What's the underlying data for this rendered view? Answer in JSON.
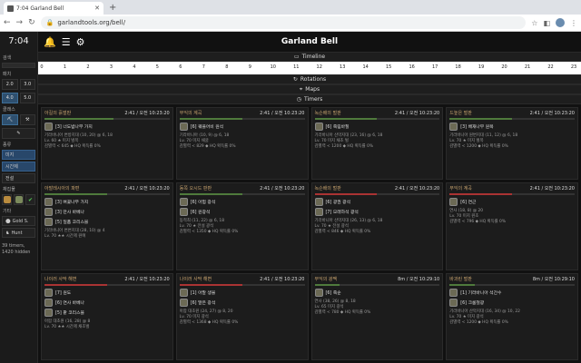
{
  "browser": {
    "tab_title": "7:04 Garland Bell",
    "url": "garlandtools.org/bell/"
  },
  "sidebar": {
    "clock": "7:04",
    "search_label": "검색",
    "patch_label": "패치",
    "patches": [
      "2.0",
      "3.0",
      "4.0",
      "5.0"
    ],
    "class_label": "클래스",
    "type_label": "종류",
    "types": [
      "미지",
      "시간제",
      "전설"
    ],
    "collect_label": "채집물",
    "other_label": "기타",
    "gold_label": "Gold S.",
    "hunt_label": "Hunt",
    "footer": "39 timers, 1420 hidden"
  },
  "header": {
    "title": "Garland Bell"
  },
  "sections": {
    "timeline": "Timeline",
    "rotations": "Rotations",
    "maps": "Maps",
    "timers": "Timers"
  },
  "timeline_hours": [
    "0",
    "1",
    "2",
    "3",
    "4",
    "5",
    "6",
    "7",
    "8",
    "9",
    "10",
    "11",
    "12",
    "13",
    "14",
    "15",
    "16",
    "17",
    "18",
    "19",
    "20",
    "21",
    "22",
    "23"
  ],
  "cards": [
    {
      "name": "아길의 흙벌판",
      "time": "2:41 / 오전 10:23:20",
      "items": [
        "[3] 너도밤나무 가지"
      ],
      "meta": [
        "기라바니아 변방지대 (10, 20) @ 6, 18",
        "Lv. 60 ★ 미지 벌목",
        "감별력 < 645 ◆ HQ 획득률 0%"
      ],
      "bar": 0.55
    },
    {
      "name": "무익의 계곡",
      "time": "2:41 / 오전 10:23:20",
      "items": [
        "[6] 퀘플어비 원석"
      ],
      "meta": [
        "기라바니아 (10, 9) @ 6, 18",
        "Lv. 70 미지 채굴",
        "감별력 < 829 ◆ HQ 획득률 0%"
      ],
      "bar": 0.5
    },
    {
      "name": "녹슨배의 벌판",
      "time": "2:41 / 오전 10:23:20",
      "items": [
        "[6] 죽림바질"
      ],
      "meta": [
        "기라바니아 산악지대 (23, 16) @ 6, 18",
        "Lv. 70 미지 채초 벌",
        "감별력 < 1200 ◆ HQ 획득률 0%"
      ],
      "bar": 0.5
    },
    {
      "name": "드높은 벌판",
      "time": "2:41 / 오전 10:23:20",
      "items": [
        "[3] 배재나무 원목"
      ],
      "meta": [
        "기라바니아 원변지대 (11, 12) @ 6, 18",
        "Lv. 70 ★ 미지 벌목",
        "감별력 < 1200 ◆ HQ 획득률 0%"
      ],
      "bar": 0.5
    },
    {
      "name": "아발레시아의 파편",
      "time": "2:41 / 오전 10:23:20",
      "items": [
        "[3] 벼꽃나무 가지",
        "[3] 만사 바베나",
        "[5] 일품 코리스블"
      ],
      "meta": [
        "기라바니아 변변지대 (28, 10) @ 4",
        "Lv. 70 ★★ 시간제 원예"
      ],
      "bar": 0.5
    },
    {
      "name": "동쪽 오시드 판판",
      "time": "2:41 / 오전 10:23:20",
      "items": [
        "[6] 아험 광석",
        "[6] 원광석"
      ],
      "meta": [
        "동적최 (11, 22) @ 6, 18",
        "Lv. 70 ★ 전설 광석",
        "감별력 < 1350 ◆ HQ 획득률 0%"
      ],
      "bar": 0.5
    },
    {
      "name": "녹슨배의 벌판",
      "time": "2:41 / 오전 10:23:20",
      "items": [
        "[6] 광권 광석",
        "[7] 모래하석 광석"
      ],
      "meta": [
        "기라바니아 산악지대 (26, 13) @ 6, 18",
        "Lv. 70 ★ 전설 광석",
        "감별력 < 846 ◆ HQ 획득률 0%"
      ],
      "bar": 0.5,
      "red": true
    },
    {
      "name": "무익의 계곡",
      "time": "2:41 / 오전 10:23:20",
      "items": [
        "[6] 연근"
      ],
      "meta": [
        "연사 (18, 8) @ 20",
        "Lv. 70 미지 원초",
        "감별력 < 796 ◆ HQ 획득률 0%"
      ],
      "bar": 0.5,
      "red": true
    },
    {
      "name": "나이러 사막 해변",
      "time": "2:41 / 오전 10:23:20",
      "items": [
        "[7] 원도",
        "[6] 연사 바베나",
        "[5] 팥 코리스블"
      ],
      "meta": [
        "아팜 대초원 (16, 28) @ 8",
        "Lv. 70 ★★ 시간제 채초벌"
      ],
      "bar": 0.5,
      "red": true
    },
    {
      "name": "나이러 사막 해변",
      "time": "2:41 / 오전 10:23:20",
      "items": [
        "[1] 아말 생물",
        "[6] 말은 광석"
      ],
      "meta": [
        "아팜 대초원 (24, 27) @ 8, 20",
        "Lv. 70 미지 광석",
        "감별력 < 1368 ◆ HQ 획득률 0%"
      ],
      "bar": 0.5,
      "red": true
    },
    {
      "name": "무익의 광맥",
      "time": "8m / 오전 10:29:10",
      "items": [
        "[6] 죽순"
      ],
      "meta": [
        "연사 (38, 26) @ 8, 18",
        "Lv. 65 미지 광석",
        "감별력 < 780 ◆ HQ 획득률 0%"
      ],
      "bar": 0.2
    },
    {
      "name": "바과린 벌판",
      "time": "8m / 오전 10:29:10",
      "items": [
        "[1] 기라바니아 석간수",
        "[6] 크롬철광"
      ],
      "meta": [
        "기라바니아 산악지대 (16, 34) @ 10, 22",
        "Lv. 70 ★ 미지 광석",
        "감별력 < 1200 ◆ HQ 획득률 0%"
      ],
      "bar": 0.2
    }
  ]
}
